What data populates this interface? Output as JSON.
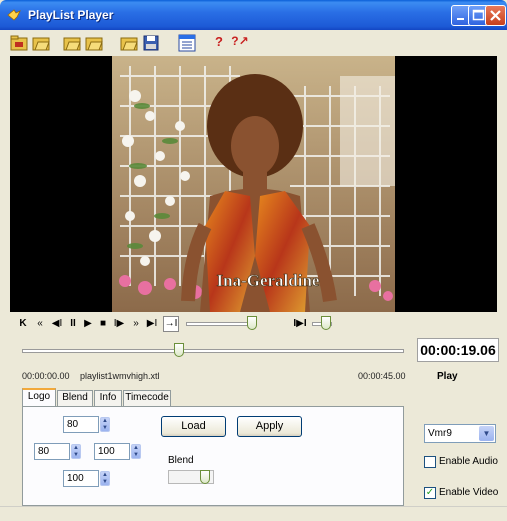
{
  "window": {
    "title": "PlayList Player"
  },
  "toolbar": {
    "icons": [
      "folder-open-icon",
      "folder-open-icon",
      "folder-open-icon",
      "folder-open-icon",
      "folder-open-icon",
      "save-icon",
      "list-icon",
      "help-icon",
      "help-context-icon"
    ],
    "help_glyph": "?",
    "help_context_glyph": "?↗"
  },
  "video": {
    "caption": "Ina-Geraldine"
  },
  "transport": {
    "buttons": [
      {
        "name": "skip-to-start-icon",
        "glyph": "K"
      },
      {
        "name": "rewind-icon",
        "glyph": "«"
      },
      {
        "name": "step-back-icon",
        "glyph": "◀I"
      },
      {
        "name": "pause-icon",
        "glyph": "II"
      },
      {
        "name": "play-icon",
        "glyph": "▶"
      },
      {
        "name": "stop-icon",
        "glyph": "■"
      },
      {
        "name": "step-forward-icon",
        "glyph": "I▶"
      },
      {
        "name": "fast-forward-icon",
        "glyph": "»"
      },
      {
        "name": "skip-to-end-icon",
        "glyph": "▶I"
      },
      {
        "name": "loop-icon",
        "glyph": "→I"
      }
    ],
    "volume_glyph": "I▶I"
  },
  "position": {
    "progress_fraction": 0.41,
    "start_time": "00:00:00.00",
    "filename": "playlist1wmvhigh.xtl",
    "end_time": "00:00:45.00",
    "current_time": "00:00:19.06",
    "status": "Play"
  },
  "tabs": [
    {
      "label": "Logo",
      "active": true
    },
    {
      "label": "Blend",
      "active": false
    },
    {
      "label": "Info",
      "active": false
    },
    {
      "label": "Timecode",
      "active": false
    }
  ],
  "logo_panel": {
    "top_value": "80",
    "left_value": "80",
    "right_value": "100",
    "bottom_value": "100",
    "load_label": "Load",
    "apply_label": "Apply",
    "blend_label": "Blend",
    "blend_fraction": 0.8
  },
  "options": {
    "renderer_value": "Vmr9",
    "enable_audio_label": "Enable Audio",
    "enable_audio_checked": false,
    "enable_video_label": "Enable Video",
    "enable_video_checked": true
  }
}
